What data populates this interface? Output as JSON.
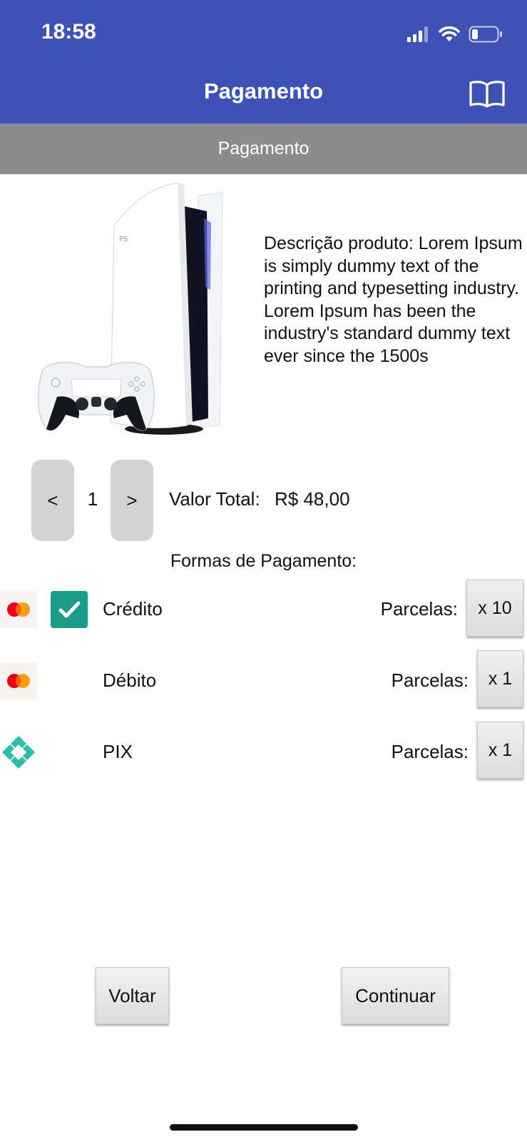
{
  "status_bar": {
    "time": "18:58",
    "icons": [
      "signal-icon",
      "wifi-icon",
      "battery-icon"
    ],
    "battery_level": 0.2
  },
  "header": {
    "title": "Pagamento",
    "right_icon": "book-icon",
    "background": "#3f51b5"
  },
  "subheader": {
    "title": "Pagamento",
    "background": "#8c8c8c"
  },
  "product": {
    "image": "console-with-controller-image",
    "description": "Descrição produto: Lorem Ipsum is simply dummy text of the printing and typesetting industry. Lorem Ipsum has been the industry's standard dummy text ever since the 1500s"
  },
  "quantity": {
    "decrease_label": "<",
    "value": "1",
    "increase_label": ">"
  },
  "total": {
    "label": "Valor Total:",
    "value": "R$ 48,00"
  },
  "payment": {
    "title": "Formas de Pagamento:",
    "methods": [
      {
        "icon": "mastercard-icon",
        "name": "Crédito",
        "checked": true,
        "parcelas_label": "Parcelas:",
        "parcelas_value": "x 10"
      },
      {
        "icon": "mastercard-icon",
        "name": "Débito",
        "checked": false,
        "parcelas_label": "Parcelas:",
        "parcelas_value": "x 1"
      },
      {
        "icon": "pix-icon",
        "name": "PIX",
        "checked": false,
        "parcelas_label": "Parcelas:",
        "parcelas_value": "x 1"
      }
    ],
    "check_color": "#1a9b86"
  },
  "actions": {
    "back_label": "Voltar",
    "continue_label": "Continuar"
  }
}
